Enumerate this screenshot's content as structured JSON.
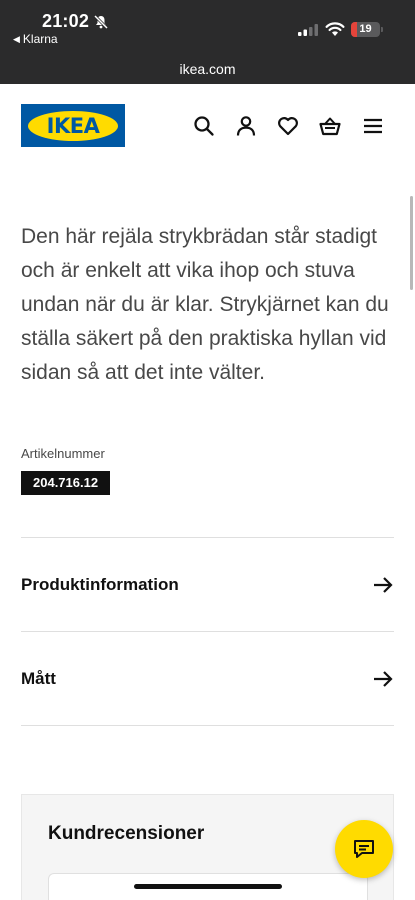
{
  "status_bar": {
    "time": "21:02",
    "back_app": "Klarna",
    "battery_level": "19",
    "battery_fraction": 0.19,
    "battery_color": "#e5443b"
  },
  "browser": {
    "url": "ikea.com"
  },
  "header": {
    "logo_text": "IKEA",
    "brand_blue": "#0058a3",
    "brand_yellow": "#ffdb00",
    "icons": [
      "search-icon",
      "account-icon",
      "heart-icon",
      "basket-icon",
      "menu-icon"
    ]
  },
  "product": {
    "description": "Den här rejäla strykbrädan står stadigt och är enkelt att vika ihop och stuva undan när du är klar. Strykjärnet kan du ställa säkert på den praktiska hyllan vid sidan så att det inte välter.",
    "article_label": "Artikelnummer",
    "article_number": "204.716.12"
  },
  "sections": [
    {
      "label": "Produktinformation"
    },
    {
      "label": "Mått"
    }
  ],
  "reviews": {
    "title": "Kundrecensioner"
  }
}
